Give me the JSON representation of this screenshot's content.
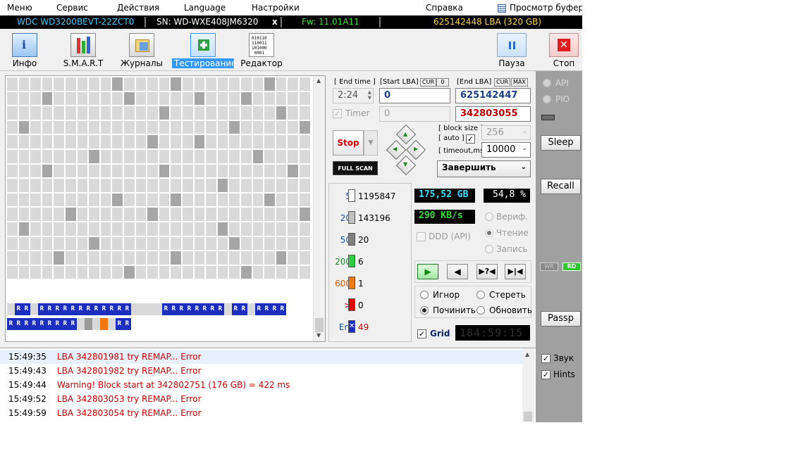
{
  "menu": {
    "items": [
      "Меню",
      "Сервис",
      "Действия",
      "Language",
      "Настройки",
      "Справка"
    ],
    "clipboard_label": "Просмотр буфера"
  },
  "drive": {
    "model": "WDC WD3200BEVT-22ZCT0",
    "serial": "SN: WD-WXE408JM6320",
    "close": "x",
    "firmware": "Fw: 11.01A11",
    "capacity": "625142448 LBA (320 GB)"
  },
  "toolbar": {
    "info": "Инфо",
    "smart": "S.M.A.R.T",
    "journals": "Журналы",
    "testing": "Тестирование",
    "editor": "Редактор",
    "pause": "Пауза",
    "stop": "Стоп"
  },
  "map": {
    "cols": 26,
    "rows": 16,
    "cells": [
      "gggggggggggggggggggggggggg",
      "ggggggggggggggggggggggggggg",
      "gggggggggggggggggggggggggg",
      "gggggggggggggggggggggggggg",
      "gggggggggggggggggggggggggg",
      "gggggggggggggggggggggggggg",
      "gggggggggggggggggggggggggg",
      "gggggggggggggggggggggggggg",
      "gggggggggggggggggggggggggg",
      "gggggggggggggggggggggggggg",
      "gggggggggggggggggggggggggg",
      "gggggggggggggggggggggggggg",
      "gggggggggggggggggggggggggg",
      "gggggggggggggggggggggggggg",
      "gBBgBBBBBBBBBBBBgggBBBBBBBBgBBgBBBB",
      "BBBBBBBBBgDgOgBB"
    ],
    "dark_cells": [
      [
        0,
        9
      ],
      [
        0,
        14
      ],
      [
        0,
        22
      ],
      [
        1,
        3
      ],
      [
        1,
        10
      ],
      [
        1,
        16
      ],
      [
        1,
        20
      ],
      [
        2,
        13
      ],
      [
        2,
        23
      ],
      [
        3,
        1
      ],
      [
        3,
        19
      ],
      [
        3,
        25
      ],
      [
        4,
        12
      ],
      [
        4,
        16
      ],
      [
        5,
        7
      ],
      [
        5,
        21
      ],
      [
        6,
        3
      ],
      [
        6,
        13
      ],
      [
        6,
        24
      ],
      [
        7,
        18
      ],
      [
        8,
        9
      ],
      [
        8,
        14
      ],
      [
        8,
        22
      ],
      [
        9,
        5
      ],
      [
        9,
        12
      ],
      [
        9,
        25
      ],
      [
        10,
        1
      ],
      [
        10,
        18
      ],
      [
        11,
        7
      ],
      [
        11,
        19
      ],
      [
        12,
        4
      ],
      [
        12,
        14
      ],
      [
        12,
        23
      ],
      [
        13,
        10
      ],
      [
        13,
        20
      ]
    ]
  },
  "controls": {
    "end_time_label": "[ End time ]",
    "end_time_value": "2:24",
    "timer_label": "Timer",
    "start_lba_label": "[Start LBA]",
    "start_lba_value": "0",
    "start_lba_current": "0",
    "cur_label": "CUR",
    "zero_label": "0",
    "end_lba_label": "[End LBA]",
    "end_lba_value": "625142447",
    "current_lba_value": "342803055",
    "max_label": "MAX",
    "stop_label": "Stop",
    "full_scan_label": "FULL SCAN",
    "block_size_label": "[ block size ]",
    "auto_label": "[ auto ]",
    "block_size_value": "256",
    "timeout_label": "[ timeout,ms ]",
    "timeout_value": "10000",
    "finish_action": "Завершить"
  },
  "stats": [
    {
      "label": "5",
      "count": "1195847",
      "color": "#ffffff",
      "label_color": "#1a4fa0"
    },
    {
      "label": "20",
      "count": "143196",
      "color": "#c0c0c0",
      "label_color": "#1a4fa0"
    },
    {
      "label": "50",
      "count": "20",
      "color": "#808080",
      "label_color": "#1a4fa0"
    },
    {
      "label": "200",
      "count": "6",
      "color": "#2ecc40",
      "label_color": "#1a8a2a"
    },
    {
      "label": "600",
      "count": "1",
      "color": "#f07a10",
      "label_color": "#d05a00"
    },
    {
      "label": ">",
      "count": "0",
      "color": "#e00000",
      "label_color": "#d00000"
    },
    {
      "label": "Err",
      "count": "49",
      "color": "#1a2fbf",
      "label_color": "#1a4fa0"
    }
  ],
  "status": {
    "scanned": "175,52 GB",
    "percent": "54,8  %",
    "speed": "290 KB/s",
    "verify_label": "Вериф.",
    "read_label": "Чтение",
    "write_label": "Запись",
    "ddd_label": "DDD (API)",
    "ignore_label": "Игнор",
    "erase_label": "Стереть",
    "repair_label": "Починить",
    "refresh_label": "Обновить",
    "grid_label": "Grid",
    "elapsed": "184:59:15"
  },
  "side": {
    "api_label": "API",
    "pio_label": "PIO",
    "sleep_label": "Sleep",
    "recall_label": "Recall",
    "wr_label": "WR",
    "rd_label": "RD",
    "passp_label": "Passp",
    "sound_label": "Звук",
    "hints_label": "Hints"
  },
  "log": [
    {
      "time": "15:49:35",
      "msg": "LBA 342801981 try REMAP... Error"
    },
    {
      "time": "15:49:43",
      "msg": "LBA 342801982 try REMAP... Error"
    },
    {
      "time": "15:49:44",
      "msg": "Warning! Block start at 342802751 (176 GB)  = 422 ms"
    },
    {
      "time": "15:49:52",
      "msg": "LBA 342803053 try REMAP... Error"
    },
    {
      "time": "15:49:59",
      "msg": "LBA 342803054 try REMAP... Error"
    }
  ]
}
